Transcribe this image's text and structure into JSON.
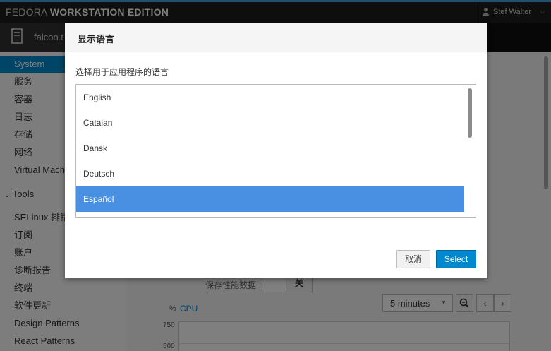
{
  "header": {
    "brand_light": "FEDORA ",
    "brand_bold": "WORKSTATION EDITION",
    "user_name": "Stef Walter",
    "user_icon": "user-icon"
  },
  "host": {
    "name": "falcon.t",
    "icon": "server-icon"
  },
  "sidebar": {
    "items": [
      {
        "label": "System",
        "active": true
      },
      {
        "label": "服务"
      },
      {
        "label": "容器"
      },
      {
        "label": "日志"
      },
      {
        "label": "存储"
      },
      {
        "label": "网络"
      },
      {
        "label": "Virtual Machines"
      }
    ],
    "tools_group": "Tools",
    "tools": [
      {
        "label": "SELinux 排错"
      },
      {
        "label": "订阅"
      },
      {
        "label": "账户"
      },
      {
        "label": "诊断报告"
      },
      {
        "label": "终端"
      },
      {
        "label": "软件更新"
      },
      {
        "label": "Design Patterns"
      },
      {
        "label": "React Patterns"
      }
    ]
  },
  "main": {
    "perf_label": "保存性能数据",
    "perf_toggle_on": "关",
    "cpu_unit": "%",
    "cpu_label": "CPU",
    "time_range": "5 minutes",
    "y_ticks": [
      "750",
      "500"
    ]
  },
  "dialog": {
    "title": "显示语言",
    "prompt": "选择用于应用程序的语言",
    "languages": [
      "English",
      "Catalan",
      "Dansk",
      "Deutsch",
      "Español"
    ],
    "selected": "Español",
    "cancel_label": "取消",
    "select_label": "Select"
  },
  "colors": {
    "accent": "#0088ce",
    "selection": "#4a90e2",
    "header_bg": "#1c1c1c"
  }
}
